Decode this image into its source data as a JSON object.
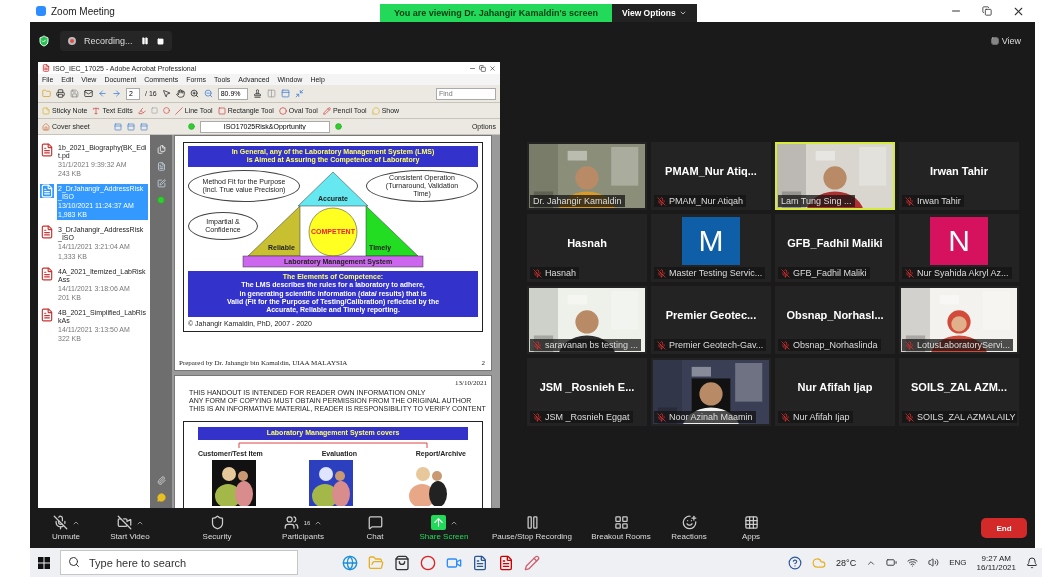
{
  "window": {
    "title": "Zoom Meeting"
  },
  "banner": {
    "text": "You are viewing Dr. Jahangir Kamaldin's screen",
    "view_options": "View Options"
  },
  "recording": {
    "label": "Recording..."
  },
  "view_button": "View",
  "shared_screen": {
    "title": "ISO_IEC_17025 - Adobe Acrobat Professional",
    "menu": [
      "File",
      "Edit",
      "View",
      "Document",
      "Comments",
      "Forms",
      "Tools",
      "Advanced",
      "Window",
      "Help"
    ],
    "page_field": "2",
    "page_count": "/ 16",
    "zoom_field": "80.9%",
    "find_placeholder": "Find",
    "tools": [
      "Sticky Note",
      "Text Edits",
      "Line Tool",
      "Rectangle Tool",
      "Oval Tool",
      "Pencil Tool",
      "Show"
    ],
    "nav": {
      "cover": "Cover sheet",
      "bookmark": "ISO17025Risk&Opprtunity",
      "options": "Options"
    },
    "files": [
      {
        "name": "1b_2021_Biography(BK_Edit.pd",
        "date": "31/1/2021 9:39:32 AM",
        "size": "243 KB",
        "selected": false
      },
      {
        "name": "2_DrJahangir_AddressRisk_ISO",
        "date": "13/10/2021 11:24:37 AM",
        "size": "1,983 KB",
        "selected": true
      },
      {
        "name": "3_DrJahangir_AddressRisk_ISO",
        "date": "14/11/2021 3:21:04 AM",
        "size": "1,333 KB",
        "selected": false
      },
      {
        "name": "4A_2021_Itemized_LabRiskAss",
        "date": "14/11/2021 3:18:06 AM",
        "size": "201 KB",
        "selected": false
      },
      {
        "name": "4B_2021_Simplified_LabRiskAs",
        "date": "14/11/2021 3:13:50 AM",
        "size": "322 KB",
        "selected": false
      }
    ],
    "page1": {
      "heading": [
        "In General, any of the Laboratory Management System (LMS)",
        "is Aimed at Assuring the Competence of Laboratory"
      ],
      "diagram": {
        "top": "Accurate",
        "left": "Reliable",
        "right": "Timely",
        "center": "COMPETENT",
        "base": "Laboratory Management System",
        "callouts": [
          "Method Fit for the Purpose (Incl. True value Precision)",
          "Consistent Operation (Turnaround, Validation Time)",
          "Impartial & Confidence"
        ]
      },
      "elements": [
        "The Elements of Competence:",
        "The LMS describes the rules for a laboratory to adhere,",
        "in generating scientific information (data/ results) that is",
        "Valid (Fit for the Purpose of Testing/Calibration) reflected by the",
        "Accurate, Reliable and Timely reporting."
      ],
      "copyright": "© Jahangir Kamaldin, PhD, 2007 - 2020",
      "footer": "Prepared by Dr. Jahangir bin Kamaldin, UIAA MALAYSIA",
      "page_number": "2"
    },
    "page2": {
      "date": "13/10/2021",
      "notice": [
        "THIS HANDOUT IS INTENDED FOR READER OWN INFORMATION ONLY",
        "ANY FORM OF COPYING MUST OBTAIN PERMISSION FROM THE ORIGINAL AUTHOR",
        "THIS IS AN INFORMATIVE MATERIAL, READER IS RESPONSIBILITY TO VERIFY CONTENT"
      ],
      "slide_heading": "Laboratory Management System covers",
      "columns": [
        "Customer/Test Item",
        "Evaluation",
        "Report/Archive"
      ]
    }
  },
  "participants": [
    {
      "kind": "video",
      "label": "Dr. Jahangir Kamaldin",
      "muted": false,
      "speaking": false
    },
    {
      "kind": "name",
      "name": "PMAM_Nur  Atiq...",
      "label": "PMAM_Nur Atiqah",
      "muted": true,
      "speaking": false
    },
    {
      "kind": "video",
      "label": "Lam Tung Sing ...",
      "muted": false,
      "speaking": true
    },
    {
      "kind": "name",
      "name": "Irwan Tahir",
      "label": "Irwan Tahir",
      "muted": true,
      "speaking": false
    },
    {
      "kind": "name",
      "name": "Hasnah",
      "label": "Hasnah",
      "muted": true,
      "speaking": false
    },
    {
      "kind": "avatar",
      "letter": "M",
      "color": "#0f5fa8",
      "label": "Master Testing Servic...",
      "muted": true,
      "speaking": false
    },
    {
      "kind": "name",
      "name": "GFB_Fadhil Maliki",
      "label": "GFB_Fadhil Maliki",
      "muted": true,
      "speaking": false
    },
    {
      "kind": "avatar",
      "letter": "N",
      "color": "#d6125f",
      "label": "Nur Syahida Akryl Az...",
      "muted": true,
      "speaking": false
    },
    {
      "kind": "video",
      "label": "saravanan bs testing ...",
      "muted": true,
      "speaking": false
    },
    {
      "kind": "name",
      "name": "Premier  Geotec...",
      "label": "Premier Geotech-Gav...",
      "muted": true,
      "speaking": false
    },
    {
      "kind": "name",
      "name": "Obsnap_Norhasl...",
      "label": "Obsnap_Norhaslinda",
      "muted": true,
      "speaking": false
    },
    {
      "kind": "video",
      "label": "LotusLaboratoryServi...",
      "muted": true,
      "speaking": false
    },
    {
      "kind": "name",
      "name": "JSM _Rosnieh  E...",
      "label": "JSM _Rosnieh Eggat",
      "muted": true,
      "speaking": false
    },
    {
      "kind": "video",
      "label": "Noor Azinah Maamin",
      "muted": true,
      "speaking": false
    },
    {
      "kind": "name",
      "name": "Nur Afifah Ijap",
      "label": "Nur Afifah Ijap",
      "muted": true,
      "speaking": false
    },
    {
      "kind": "name",
      "name": "SOILS_ZAL  AZM...",
      "label": "SOILS_ZAL AZMALAILY",
      "muted": true,
      "speaking": false
    }
  ],
  "toolbar": [
    {
      "label": "Unmute",
      "caret": true
    },
    {
      "label": "Start Video",
      "caret": true
    },
    {
      "label": "Security",
      "caret": false
    },
    {
      "label": "Participants",
      "count": "16",
      "caret": true
    },
    {
      "label": "Chat",
      "caret": false
    },
    {
      "label": "Share Screen",
      "caret": true
    },
    {
      "label": "Pause/Stop Recording",
      "caret": false
    },
    {
      "label": "Breakout Rooms",
      "caret": false
    },
    {
      "label": "Reactions",
      "caret": false
    },
    {
      "label": "Apps",
      "caret": false
    }
  ],
  "end_button": "End",
  "taskbar": {
    "search_placeholder": "Type here to search",
    "weather": "28°C",
    "language": "ENG",
    "time": "9:27 AM",
    "date": "16/11/2021"
  }
}
